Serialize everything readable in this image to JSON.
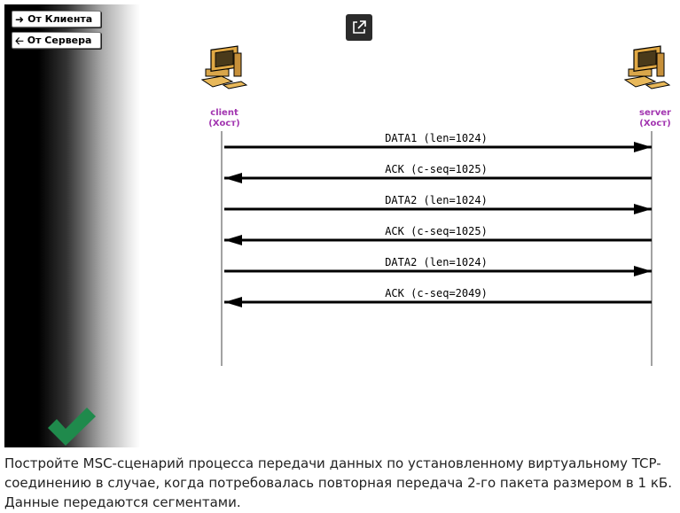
{
  "sidebar": {
    "buttons": [
      {
        "label": "От Клиента",
        "icon": "arrow-right-icon"
      },
      {
        "label": "От Сервера",
        "icon": "arrow-left-icon"
      }
    ],
    "status_icon": "checkmark-icon",
    "status_color": "#1f8a4c"
  },
  "toolbar": {
    "popout_icon": "external-link-icon"
  },
  "diagram": {
    "hosts": [
      {
        "name": "client",
        "role": "(Хост)"
      },
      {
        "name": "server",
        "role": "(Хост)"
      }
    ],
    "messages": [
      {
        "label": "DATA1 (len=1024)",
        "direction": "client-to-server"
      },
      {
        "label": "ACK (c-seq=1025)",
        "direction": "server-to-client"
      },
      {
        "label": "DATA2 (len=1024)",
        "direction": "client-to-server"
      },
      {
        "label": "ACK (c-seq=1025)",
        "direction": "server-to-client"
      },
      {
        "label": "DATA2 (len=1024)",
        "direction": "client-to-server"
      },
      {
        "label": "ACK (c-seq=2049)",
        "direction": "server-to-client"
      }
    ],
    "label_color": "#a235b0"
  },
  "caption": "Постройте MSC-сценарий процесса передачи данных по установленному виртуальному TCP-соединению в случае, когда потребовалась повторная передача 2-го пакета размером в 1 кБ. Данные передаются сегментами."
}
